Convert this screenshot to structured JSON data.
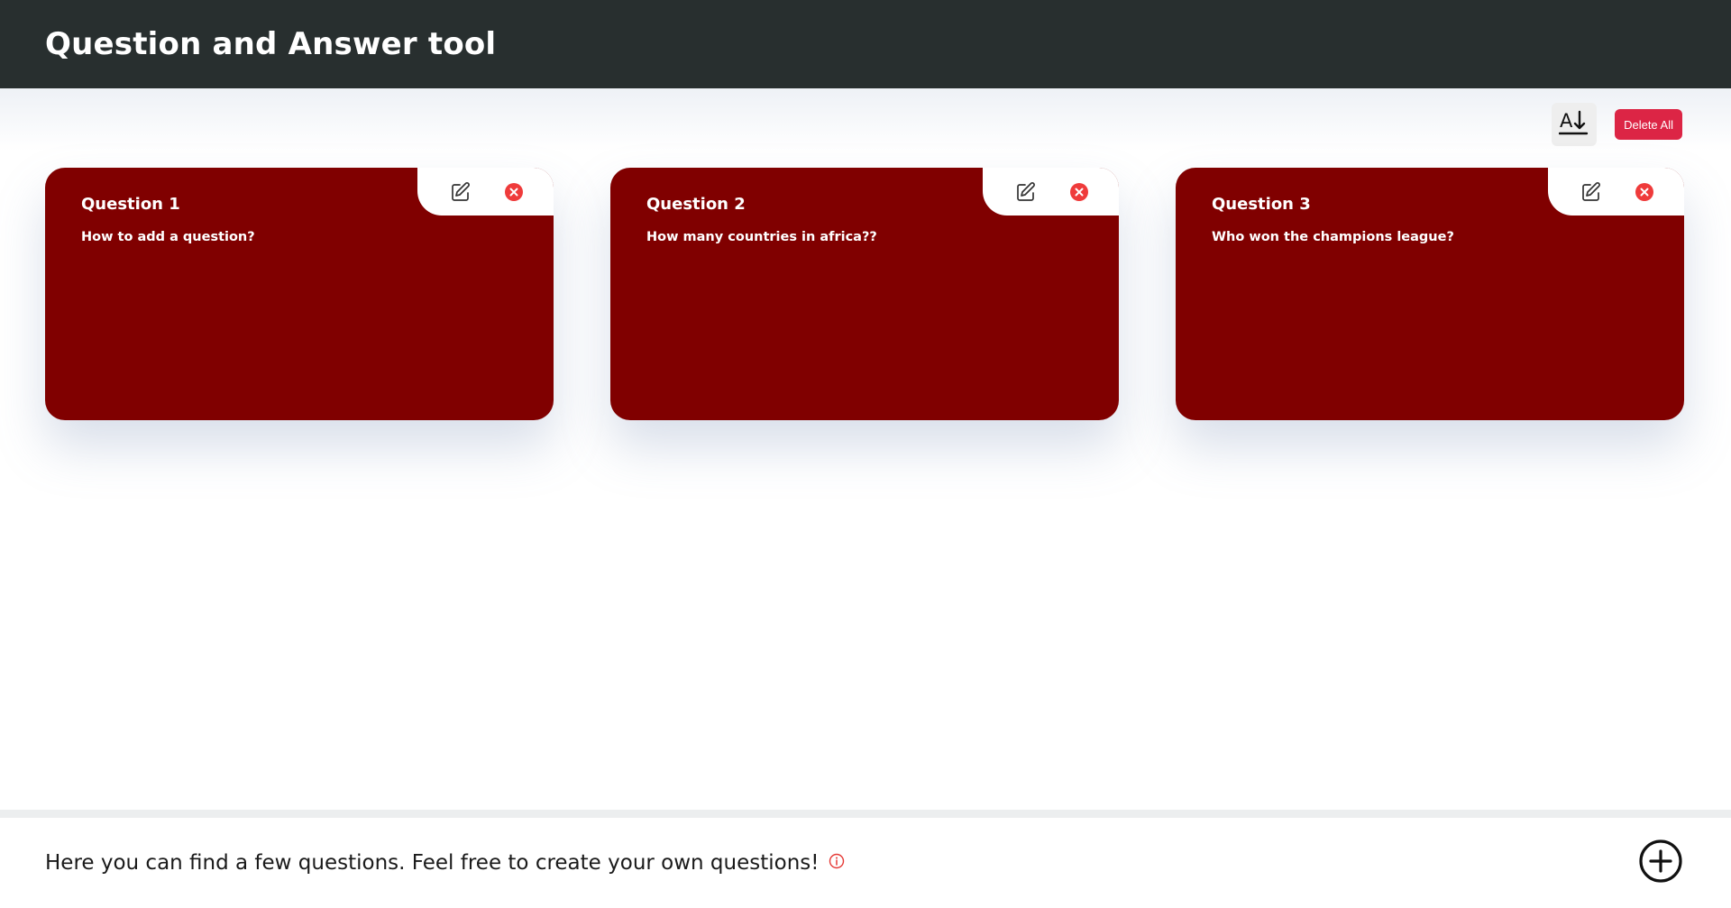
{
  "header": {
    "title": "Question and Answer tool"
  },
  "toolbar": {
    "sort_icon": "sort-alpha-down-icon",
    "delete_all_label": "Delete All",
    "delete_all_color": "#dc2545"
  },
  "cards": [
    {
      "title": "Question 1",
      "question": "How to add a question?"
    },
    {
      "title": "Question 2",
      "question": "How many countries in africa??"
    },
    {
      "title": "Question 3",
      "question": "Who won the champions league?"
    }
  ],
  "card_style": {
    "background": "#800000",
    "edit_icon": "edit-icon",
    "delete_icon": "close-circle-icon",
    "delete_icon_color": "#ef3b3b"
  },
  "footer": {
    "text": "Here you can find a few questions. Feel free to create your own questions!",
    "info_icon": "info-icon",
    "info_icon_color": "#e53935",
    "add_icon": "plus-circle-icon"
  }
}
